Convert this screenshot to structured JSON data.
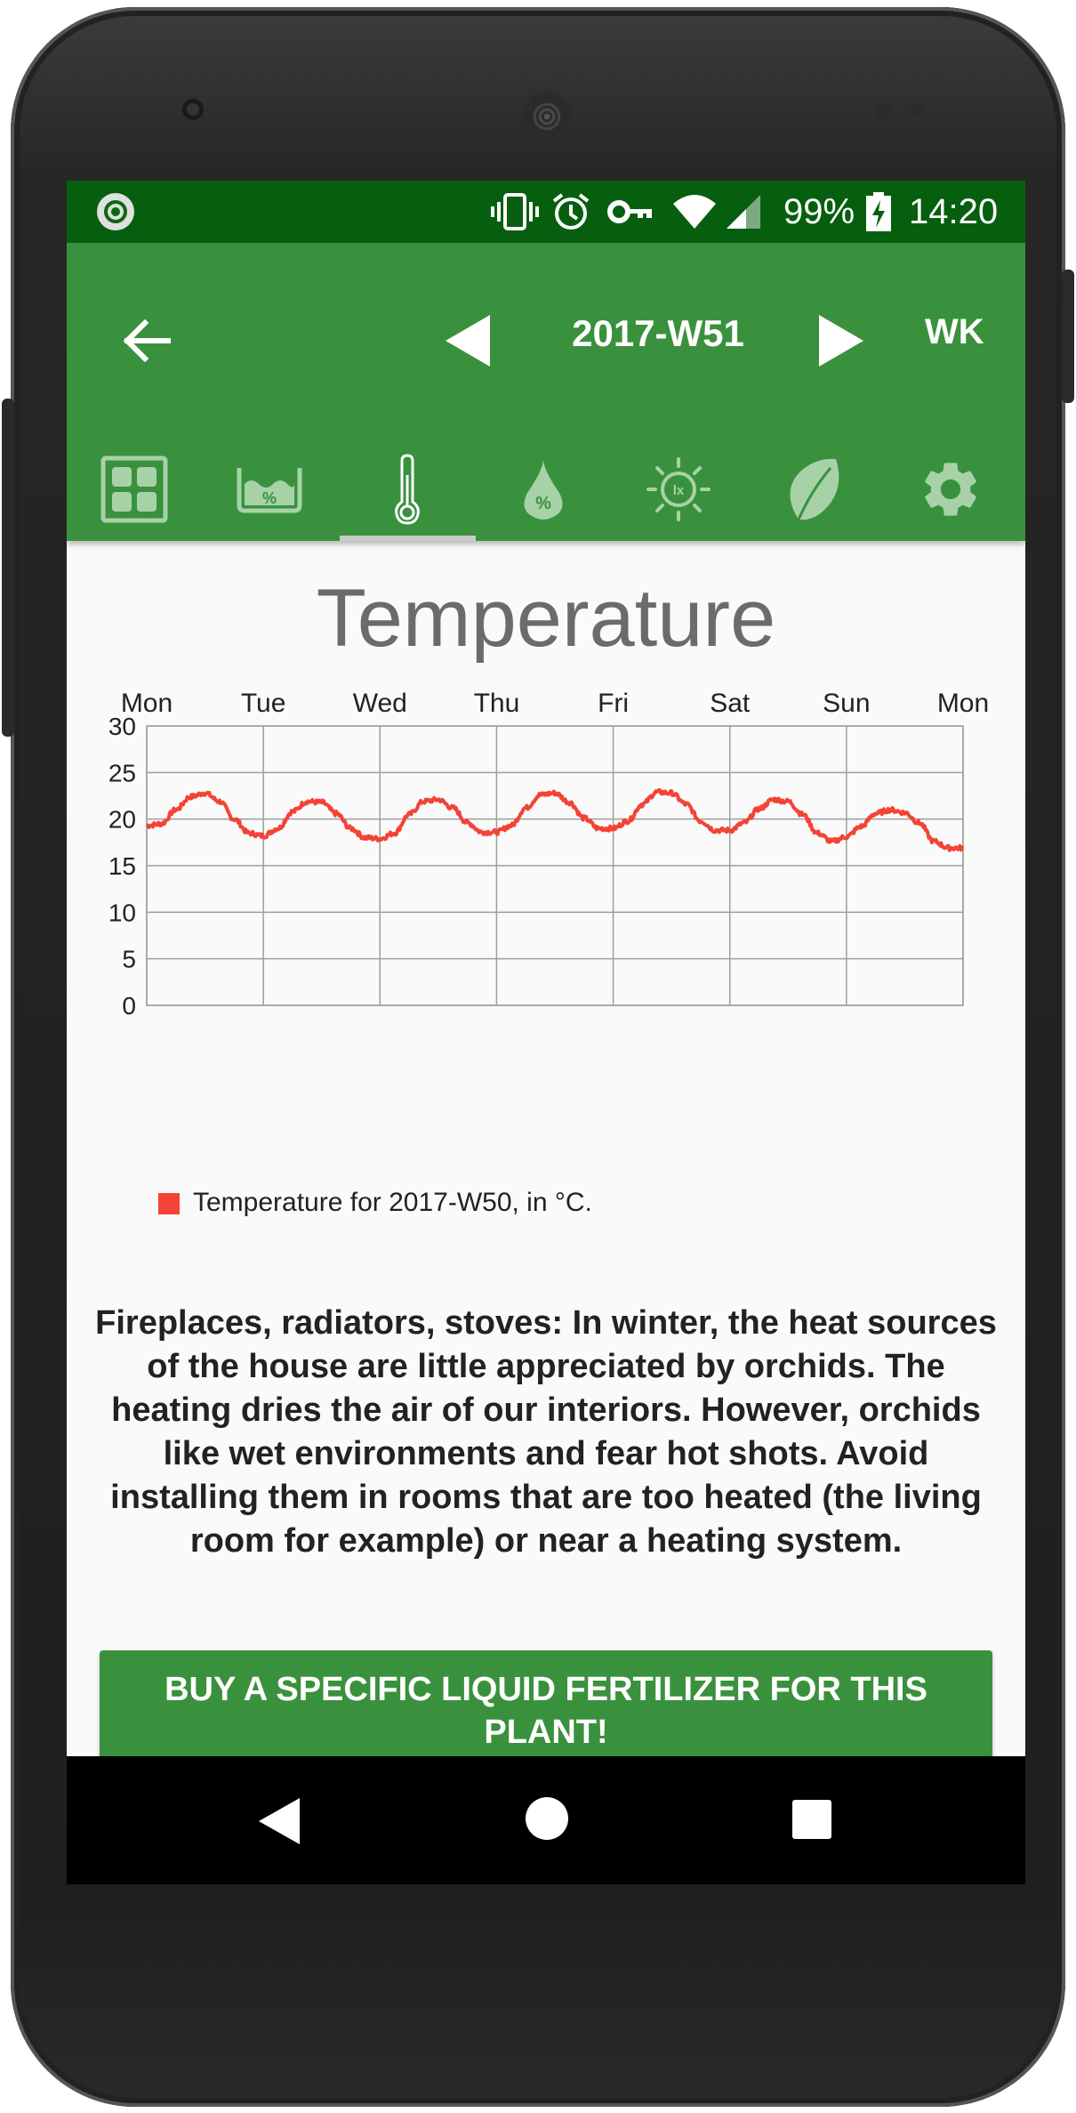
{
  "status_bar": {
    "battery": "99%",
    "time": "14:20",
    "icons": [
      "app-notification-icon",
      "vibrate-icon",
      "alarm-icon",
      "vpn-key-icon",
      "wifi-icon",
      "cell-signal-icon",
      "battery-charging-icon"
    ]
  },
  "app_bar": {
    "back_icon": "arrow-back-icon",
    "week": "2017-W51",
    "period_button": "WK",
    "colors": {
      "primary": "#3a913d",
      "status": "#065f0f"
    }
  },
  "tabs": [
    {
      "icon": "dashboard-grid-icon",
      "selected": false
    },
    {
      "icon": "soil-moisture-icon",
      "selected": false
    },
    {
      "icon": "thermometer-icon",
      "selected": true
    },
    {
      "icon": "humidity-drop-icon",
      "selected": false
    },
    {
      "icon": "light-lux-icon",
      "selected": false
    },
    {
      "icon": "leaf-icon",
      "selected": false
    },
    {
      "icon": "settings-gear-icon",
      "selected": false
    }
  ],
  "main": {
    "title": "Temperature",
    "legend": "Temperature for 2017-W50, in °C.",
    "info": "Fireplaces, radiators, stoves: In winter, the heat sources of the house are little appreciated by orchids. The heating dries the air of our interiors. However, orchids like wet environments and fear hot shots. Avoid installing them in rooms that are too heated (the living room for example) or near a heating system.",
    "buy_button": "BUY A SPECIFIC LIQUID FERTILIZER FOR THIS PLANT!"
  },
  "chart_data": {
    "type": "line",
    "x_tick_labels": [
      "Mon",
      "Tue",
      "Wed",
      "Thu",
      "Fri",
      "Sat",
      "Sun",
      "Mon"
    ],
    "y_ticks": [
      0,
      5,
      10,
      15,
      20,
      25,
      30
    ],
    "ylim": [
      0,
      30
    ],
    "grid": true,
    "legend_position": "bottom-left",
    "series": [
      {
        "name": "Temperature for 2017-W50, in °C.",
        "color": "#f44336",
        "x_days": [
          0,
          0.125,
          0.25,
          0.375,
          0.5,
          0.625,
          0.75,
          0.875,
          1.0,
          1.125,
          1.25,
          1.375,
          1.5,
          1.625,
          1.75,
          1.875,
          2.0,
          2.125,
          2.25,
          2.375,
          2.5,
          2.625,
          2.75,
          2.875,
          3.0,
          3.125,
          3.25,
          3.375,
          3.5,
          3.625,
          3.75,
          3.875,
          4.0,
          4.125,
          4.25,
          4.375,
          4.5,
          4.625,
          4.75,
          4.875,
          5.0,
          5.125,
          5.25,
          5.375,
          5.5,
          5.625,
          5.75,
          5.875,
          6.0,
          6.125,
          6.25,
          6.375,
          6.5,
          6.625,
          6.75,
          6.875,
          7.0
        ],
        "values": [
          19.3,
          19.5,
          21.0,
          22.4,
          22.8,
          21.9,
          20.0,
          18.5,
          18.2,
          19.0,
          20.8,
          21.9,
          21.8,
          20.6,
          19.0,
          18.0,
          17.9,
          18.5,
          20.5,
          21.9,
          22.1,
          21.2,
          19.6,
          18.6,
          18.6,
          19.3,
          21.2,
          22.6,
          22.8,
          21.8,
          20.1,
          19.0,
          19.0,
          19.8,
          21.6,
          22.9,
          22.8,
          21.6,
          19.8,
          18.8,
          18.8,
          19.6,
          21.1,
          22.1,
          21.9,
          20.5,
          18.5,
          17.6,
          18.1,
          19.2,
          20.6,
          21.0,
          20.7,
          19.6,
          17.6,
          16.9,
          16.9
        ]
      }
    ]
  }
}
